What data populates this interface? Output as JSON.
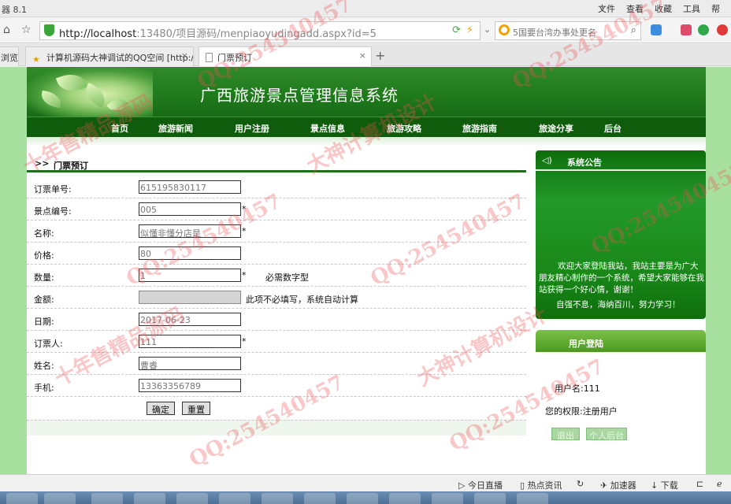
{
  "browser": {
    "app_name": "器 8.1",
    "menu": [
      "文件",
      "查看",
      "收藏",
      "工具",
      "帮"
    ],
    "url_host": "http://localhost",
    "url_rest": ":13480/项目源码/menpiaoyudingadd.aspx?id=5",
    "search_text": "5国要台湾办事处更名",
    "tabs": [
      {
        "label": "浏览"
      },
      {
        "label": "计算机源码大神调试的QQ空间 [http:/"
      },
      {
        "label": "门票预订"
      }
    ]
  },
  "site": {
    "title": "广西旅游景点管理信息系统",
    "nav": [
      "首页",
      "旅游新闻",
      "用户注册",
      "景点信息",
      "旅游攻略",
      "旅游指南",
      "旅途分享",
      "后台"
    ]
  },
  "form": {
    "arrows": ">>",
    "title": "门票预订",
    "rows": [
      {
        "label": "订票单号:",
        "value": "615195830117",
        "required": false,
        "hint": ""
      },
      {
        "label": "景点编号:",
        "value": "005",
        "required": true,
        "hint": ""
      },
      {
        "label": "名称:",
        "value": "似懂非懂分店是",
        "required": true,
        "hint": ""
      },
      {
        "label": "价格:",
        "value": "80",
        "required": false,
        "hint": ""
      },
      {
        "label": "数量:",
        "value": "1",
        "required": true,
        "hint": "必需数字型"
      },
      {
        "label": "金额:",
        "value": "",
        "required": false,
        "hint": "此项不必填写，系统自动计算"
      },
      {
        "label": "日期:",
        "value": "2017-06-23",
        "required": false,
        "hint": ""
      },
      {
        "label": "订票人:",
        "value": "111",
        "required": true,
        "hint": ""
      },
      {
        "label": "姓名:",
        "value": "曹睿",
        "required": false,
        "hint": ""
      },
      {
        "label": "手机:",
        "value": "13363356789",
        "required": false,
        "hint": ""
      }
    ],
    "required_mark": "*",
    "submit_label": "确定",
    "reset_label": "重置"
  },
  "notice": {
    "title": "系统公告",
    "body": "欢迎大家登陆我站，我站主要是为广大朋友精心制作的一个系统，希望大家能够在我站获得一个好心情，谢谢！",
    "motto": "自强不息，海纳百川，努力学习！"
  },
  "login": {
    "title": "用户登陆",
    "username_line": "用户名:111",
    "role_line": "您的权限:注册用户",
    "logout_label": "退出",
    "personal_label": "个人后台"
  },
  "statusbar": [
    "今日直播",
    "热点资讯",
    "加速器",
    "下载"
  ],
  "watermarks": [
    "QQ:254540457",
    "大神计算机设计",
    "十年售精品源码"
  ]
}
